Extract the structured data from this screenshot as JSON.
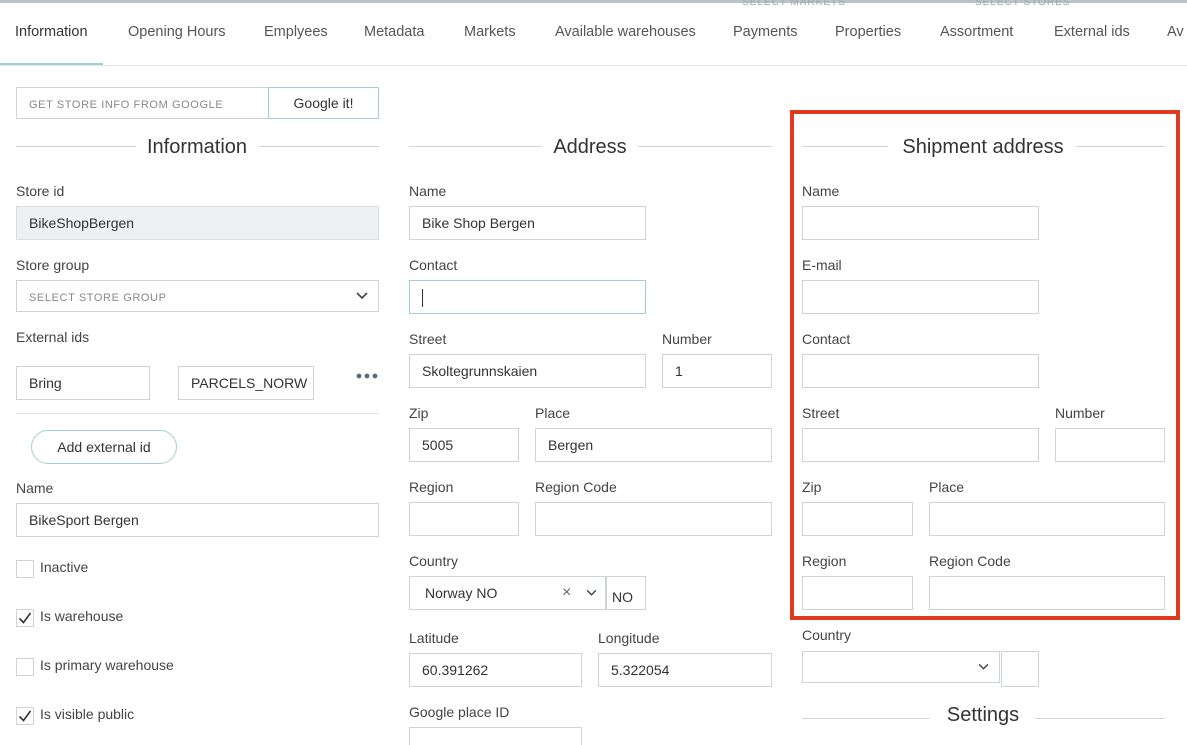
{
  "tabs": [
    {
      "label": "Information",
      "active": true
    },
    {
      "label": "Opening Hours"
    },
    {
      "label": "Emplyees"
    },
    {
      "label": "Metadata"
    },
    {
      "label": "Markets"
    },
    {
      "label": "Available warehouses"
    },
    {
      "label": "Payments"
    },
    {
      "label": "Properties"
    },
    {
      "label": "Assortment"
    },
    {
      "label": "External ids"
    },
    {
      "label": "Av"
    }
  ],
  "top_ghost": {
    "markets": "SELECT MARKETS",
    "stores": "SELECT STORES"
  },
  "google": {
    "placeholder": "GET STORE INFO FROM GOOGLE",
    "button": "Google it!"
  },
  "information": {
    "title": "Information",
    "store_id_label": "Store id",
    "store_id_value": "BikeShopBergen",
    "store_group_label": "Store group",
    "store_group_placeholder": "SELECT STORE GROUP",
    "external_ids_label": "External ids",
    "external_id_key": "Bring",
    "external_id_value": "PARCELS_NORW",
    "add_external_id": "Add external id",
    "name_label": "Name",
    "name_value": "BikeSport Bergen",
    "checkboxes": [
      {
        "label": "Inactive",
        "checked": false
      },
      {
        "label": "Is warehouse",
        "checked": true
      },
      {
        "label": "Is primary warehouse",
        "checked": false
      },
      {
        "label": "Is visible public",
        "checked": true
      }
    ]
  },
  "address": {
    "title": "Address",
    "name_label": "Name",
    "name_value": "Bike Shop Bergen",
    "contact_label": "Contact",
    "contact_value": "",
    "street_label": "Street",
    "street_value": "Skoltegrunnskaien",
    "number_label": "Number",
    "number_value": "1",
    "zip_label": "Zip",
    "zip_value": "5005",
    "place_label": "Place",
    "place_value": "Bergen",
    "region_label": "Region",
    "region_value": "",
    "region_code_label": "Region Code",
    "region_code_value": "",
    "country_label": "Country",
    "country_value": "Norway NO",
    "country_code": "NO",
    "latitude_label": "Latitude",
    "latitude_value": "60.391262",
    "longitude_label": "Longitude",
    "longitude_value": "5.322054",
    "google_place_label": "Google place ID"
  },
  "shipment": {
    "title": "Shipment address",
    "name_label": "Name",
    "email_label": "E-mail",
    "contact_label": "Contact",
    "street_label": "Street",
    "number_label": "Number",
    "zip_label": "Zip",
    "place_label": "Place",
    "region_label": "Region",
    "region_code_label": "Region Code",
    "country_label": "Country"
  },
  "settings": {
    "title": "Settings"
  },
  "colors": {
    "accent": "#9fd0d4",
    "highlight": "#e03a1e"
  }
}
